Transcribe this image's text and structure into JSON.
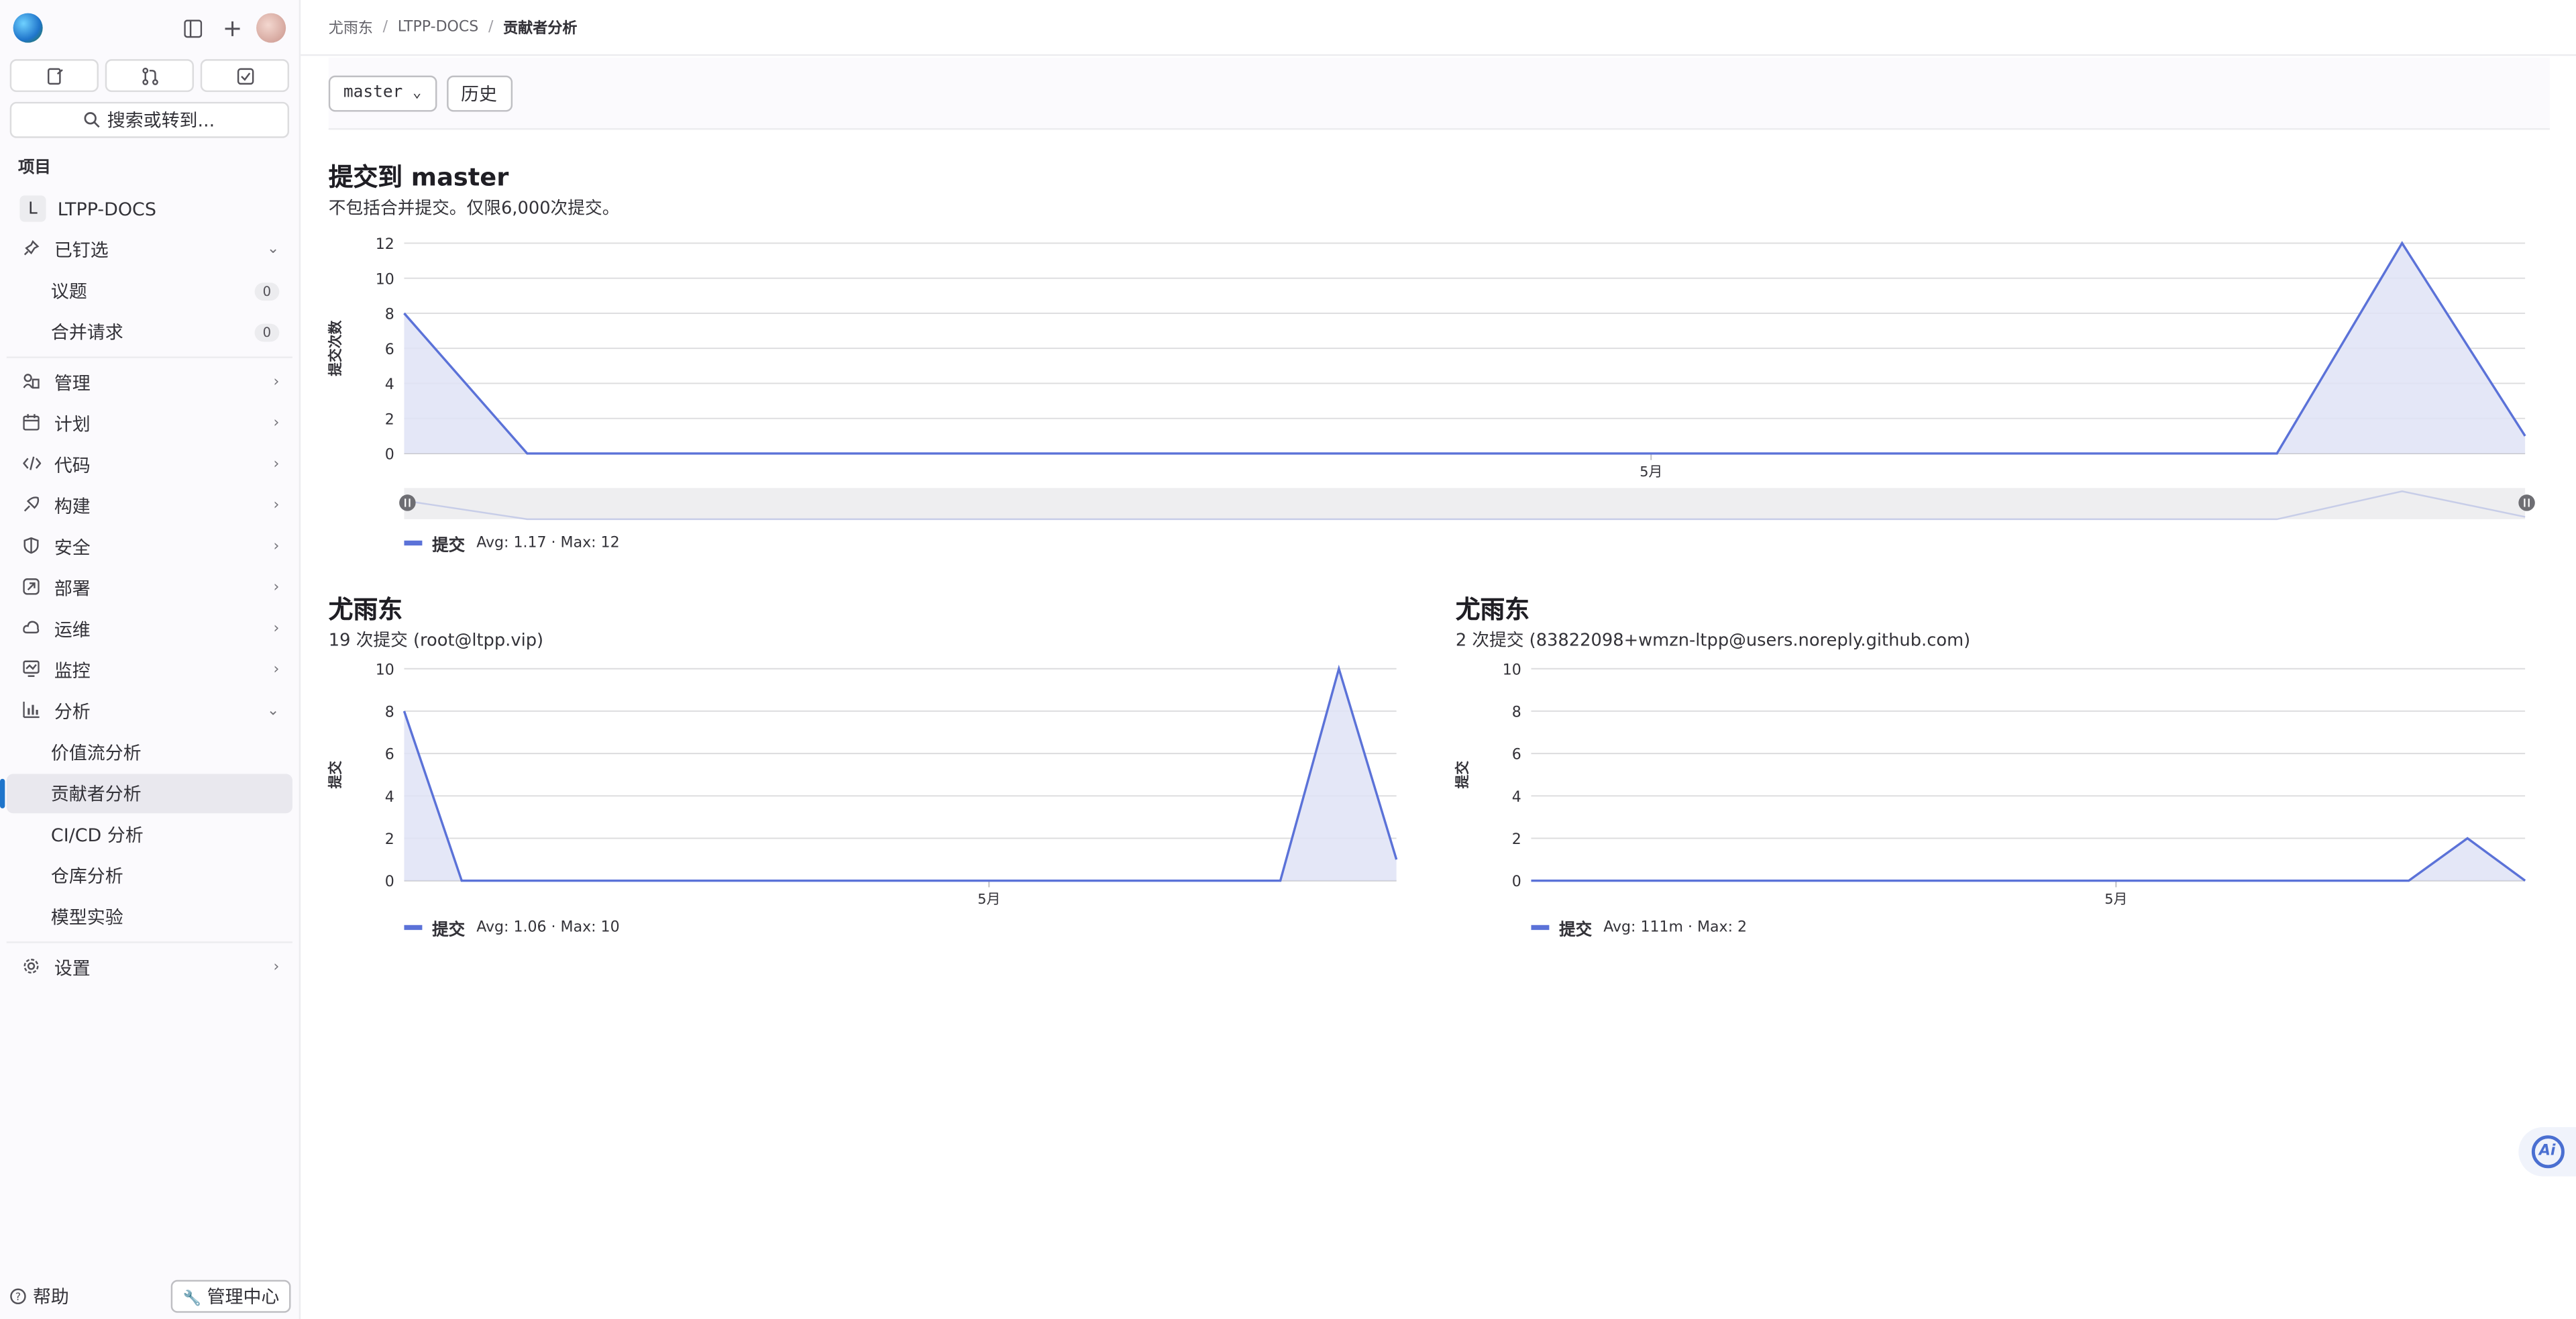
{
  "sidebar": {
    "quick_actions": [
      "issues-icon",
      "merge-request-icon",
      "todo-icon"
    ],
    "search_label": "搜索或转到...",
    "section_title": "项目",
    "project": {
      "letter": "L",
      "name": "LTPP-DOCS"
    },
    "pinned": {
      "label": "已钉选",
      "items": [
        {
          "label": "议题",
          "count": "0"
        },
        {
          "label": "合并请求",
          "count": "0"
        }
      ]
    },
    "items": [
      {
        "label": "管理",
        "icon": "manage-icon"
      },
      {
        "label": "计划",
        "icon": "plan-icon"
      },
      {
        "label": "代码",
        "icon": "code-icon"
      },
      {
        "label": "构建",
        "icon": "build-icon"
      },
      {
        "label": "安全",
        "icon": "shield-icon"
      },
      {
        "label": "部署",
        "icon": "deploy-icon"
      },
      {
        "label": "运维",
        "icon": "operate-icon"
      },
      {
        "label": "监控",
        "icon": "monitor-icon"
      }
    ],
    "analytics": {
      "label": "分析",
      "items": [
        "价值流分析",
        "贡献者分析",
        "CI/CD 分析",
        "仓库分析",
        "模型实验"
      ]
    },
    "settings": "设置",
    "help": "帮助",
    "admin": "管理中心"
  },
  "breadcrumb": [
    "尤雨东",
    "LTPP-DOCS",
    "贡献者分析"
  ],
  "toolbar": {
    "branch": "master",
    "history": "历史"
  },
  "overview": {
    "title": "提交到 master",
    "subtitle": "不包括合并提交。仅限6,000次提交。",
    "legend_name": "提交",
    "legend_stats": "Avg: 1.17 · Max: 12"
  },
  "contributors": [
    {
      "name": "尤雨东",
      "summary": "19 次提交 (root@ltpp.vip)",
      "legend_name": "提交",
      "legend_stats": "Avg: 1.06 · Max: 10"
    },
    {
      "name": "尤雨东",
      "summary": "2 次提交 (83822098+wmzn-ltpp@users.noreply.github.com)",
      "legend_name": "提交",
      "legend_stats": "Avg: 111m · Max: 2"
    }
  ],
  "colors": {
    "series": "#5b72d8",
    "fill": "#dfe3f6",
    "active": "#1f75cb"
  },
  "chart_data": [
    {
      "type": "area",
      "title": "提交到 master",
      "ylabel": "提交次数",
      "ylim": [
        0,
        12
      ],
      "yticks": [
        0,
        2,
        4,
        6,
        8,
        10,
        12
      ],
      "xtick_labels": [
        "5月"
      ],
      "series": [
        {
          "name": "提交",
          "points": [
            [
              0,
              8
            ],
            [
              0.058,
              0
            ],
            [
              0.883,
              0
            ],
            [
              0.942,
              12
            ],
            [
              1,
              1
            ]
          ]
        }
      ]
    },
    {
      "type": "area",
      "title": "尤雨东",
      "ylabel": "提交",
      "ylim": [
        0,
        10
      ],
      "yticks": [
        0,
        2,
        4,
        6,
        8,
        10
      ],
      "xtick_labels": [
        "5月"
      ],
      "series": [
        {
          "name": "提交",
          "points": [
            [
              0,
              8
            ],
            [
              0.058,
              0
            ],
            [
              0.883,
              0
            ],
            [
              0.942,
              10
            ],
            [
              1,
              1
            ]
          ]
        }
      ]
    },
    {
      "type": "area",
      "title": "尤雨东",
      "ylabel": "提交",
      "ylim": [
        0,
        10
      ],
      "yticks": [
        0,
        2,
        4,
        6,
        8,
        10
      ],
      "xtick_labels": [
        "5月"
      ],
      "series": [
        {
          "name": "提交",
          "points": [
            [
              0,
              0
            ],
            [
              0.883,
              0
            ],
            [
              0.942,
              2
            ],
            [
              1,
              0
            ]
          ]
        }
      ]
    }
  ]
}
